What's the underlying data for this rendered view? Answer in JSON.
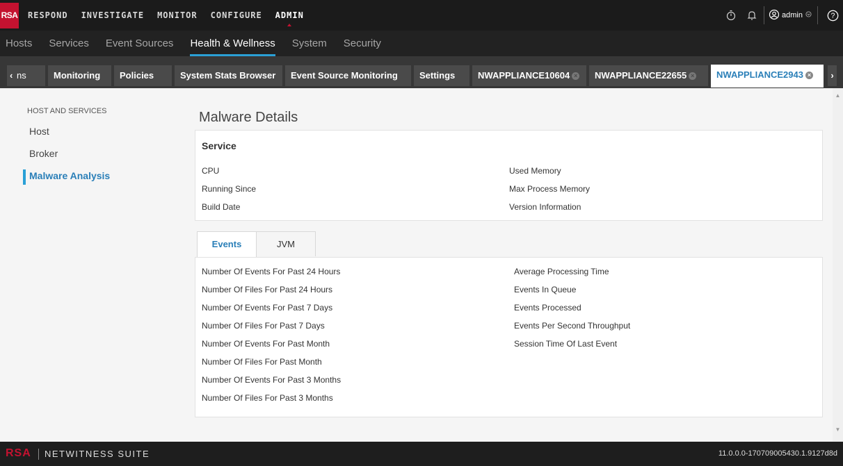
{
  "topnav": {
    "logo": "RSA",
    "items": [
      "RESPOND",
      "INVESTIGATE",
      "MONITOR",
      "CONFIGURE",
      "ADMIN"
    ],
    "active": "ADMIN",
    "user": "admin"
  },
  "subnav": {
    "items": [
      "Hosts",
      "Services",
      "Event Sources",
      "Health & Wellness",
      "System",
      "Security"
    ],
    "active": "Health & Wellness"
  },
  "tabs": {
    "partial": "ns",
    "items": [
      "Monitoring",
      "Policies",
      "System Stats Browser",
      "Event Source Monitoring",
      "Settings",
      "NWAPPLIANCE10604",
      "NWAPPLIANCE22655",
      "NWAPPLIANCE2943"
    ],
    "active": "NWAPPLIANCE2943"
  },
  "leftnav": {
    "section": "HOST AND SERVICES",
    "items": [
      "Host",
      "Broker",
      "Malware Analysis"
    ],
    "active": "Malware Analysis"
  },
  "page": {
    "title": "Malware Details"
  },
  "service_card": {
    "title": "Service",
    "left_fields": [
      "CPU",
      "Running Since",
      "Build Date"
    ],
    "right_fields": [
      "Used Memory",
      "Max Process Memory",
      "Version Information"
    ]
  },
  "panel": {
    "tabs": [
      "Events",
      "JVM"
    ],
    "active_tab": "Events",
    "left_fields": [
      "Number Of Events For Past 24 Hours",
      "Number Of Files For Past 24 Hours",
      "Number Of Events For Past 7 Days",
      "Number Of Files For Past 7 Days",
      "Number Of Events For Past Month",
      "Number Of Files For Past Month",
      "Number Of Events For Past 3 Months",
      "Number Of Files For Past 3 Months"
    ],
    "right_fields": [
      "Average Processing Time",
      "Events In Queue",
      "Events Processed",
      "Events Per Second Throughput",
      "Session Time Of Last Event"
    ]
  },
  "footer": {
    "brand_logo": "RSA",
    "brand_name": "NETWITNESS SUITE",
    "version": "11.0.0.0-170709005430.1.9127d8d"
  },
  "colors": {
    "accent": "#2aa0d6",
    "brand_red": "#c41230",
    "active_text": "#2a7fb8"
  }
}
